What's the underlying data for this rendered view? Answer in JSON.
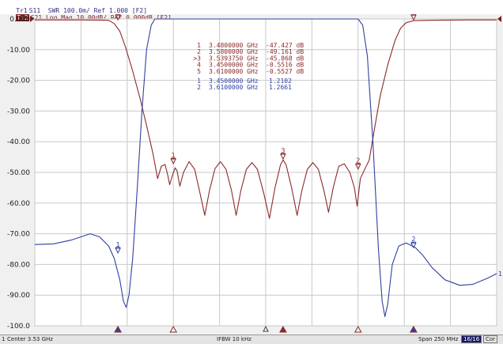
{
  "header": {
    "trace1": {
      "label": "Tr1",
      "text": "S11  SWR 100.0m/ Ref 1.000 [F2]"
    },
    "trace2": {
      "label": "Tr2",
      "text": "S21 Log Mag 10.00dB/ Ref 0.000dB [F2]"
    }
  },
  "colors": {
    "s21": "#8b2a2a",
    "s11": "#3040a0",
    "grid": "#c8c8c8",
    "plot_bg": "#ffffff",
    "ref_marker": "#7a1f1f"
  },
  "y_axis": {
    "labels": [
      "0.000",
      "-10.00",
      "-20.00",
      "-30.00",
      "-40.00",
      "-50.00",
      "-60.00",
      "-70.00",
      "-80.00",
      "-90.00",
      "-100.0"
    ]
  },
  "chart_data": {
    "type": "line",
    "x_unit": "GHz",
    "xlim": [
      3.405,
      3.655
    ],
    "ylim": [
      -100,
      0
    ],
    "y_unit": "dB",
    "grid": true,
    "series": [
      {
        "name": "S21",
        "color": "#8b2a2a",
        "points": [
          [
            3.405,
            -0.3
          ],
          [
            3.43,
            -0.3
          ],
          [
            3.44,
            -0.35
          ],
          [
            3.445,
            -0.45
          ],
          [
            3.448,
            -1.5
          ],
          [
            3.451,
            -4
          ],
          [
            3.454,
            -9
          ],
          [
            3.458,
            -17
          ],
          [
            3.462,
            -26
          ],
          [
            3.466,
            -36
          ],
          [
            3.469,
            -44
          ],
          [
            3.4715,
            -52
          ],
          [
            3.4735,
            -48
          ],
          [
            3.4755,
            -47.4
          ],
          [
            3.477,
            -51
          ],
          [
            3.478,
            -54
          ],
          [
            3.4795,
            -51
          ],
          [
            3.481,
            -48.5
          ],
          [
            3.482,
            -49.5
          ],
          [
            3.4835,
            -54.5
          ],
          [
            3.4855,
            -50
          ],
          [
            3.4885,
            -46.5
          ],
          [
            3.4915,
            -49
          ],
          [
            3.4945,
            -57
          ],
          [
            3.497,
            -64
          ],
          [
            3.4995,
            -56
          ],
          [
            3.5025,
            -48.8
          ],
          [
            3.5055,
            -46.5
          ],
          [
            3.5085,
            -49
          ],
          [
            3.5115,
            -56
          ],
          [
            3.514,
            -64
          ],
          [
            3.5165,
            -56
          ],
          [
            3.5195,
            -49
          ],
          [
            3.5225,
            -46.8
          ],
          [
            3.5255,
            -49
          ],
          [
            3.529,
            -57
          ],
          [
            3.532,
            -65
          ],
          [
            3.535,
            -55
          ],
          [
            3.538,
            -47.5
          ],
          [
            3.5394,
            -45.9
          ],
          [
            3.541,
            -47.5
          ],
          [
            3.544,
            -55
          ],
          [
            3.547,
            -64
          ],
          [
            3.5495,
            -56
          ],
          [
            3.5525,
            -49
          ],
          [
            3.5555,
            -46.8
          ],
          [
            3.5585,
            -49
          ],
          [
            3.5615,
            -56
          ],
          [
            3.564,
            -63
          ],
          [
            3.5665,
            -55
          ],
          [
            3.5695,
            -48
          ],
          [
            3.5725,
            -47.2
          ],
          [
            3.5755,
            -50
          ],
          [
            3.578,
            -55
          ],
          [
            3.5795,
            -61
          ],
          [
            3.5812,
            -52
          ],
          [
            3.584,
            -48.5
          ],
          [
            3.586,
            -46
          ],
          [
            3.5885,
            -37
          ],
          [
            3.592,
            -25
          ],
          [
            3.596,
            -15
          ],
          [
            3.6,
            -7
          ],
          [
            3.603,
            -3
          ],
          [
            3.606,
            -1.2
          ],
          [
            3.61,
            -0.55
          ],
          [
            3.62,
            -0.4
          ],
          [
            3.64,
            -0.3
          ],
          [
            3.655,
            -0.3
          ]
        ]
      },
      {
        "name": "S11",
        "color": "#3040a0",
        "points": [
          [
            3.405,
            -73.5
          ],
          [
            3.415,
            -73.3
          ],
          [
            3.425,
            -72
          ],
          [
            3.43,
            -71
          ],
          [
            3.435,
            -70
          ],
          [
            3.44,
            -71
          ],
          [
            3.445,
            -74
          ],
          [
            3.448,
            -78
          ],
          [
            3.451,
            -85
          ],
          [
            3.453,
            -92
          ],
          [
            3.4545,
            -94
          ],
          [
            3.456,
            -90
          ],
          [
            3.458,
            -78
          ],
          [
            3.4605,
            -55
          ],
          [
            3.463,
            -30
          ],
          [
            3.4655,
            -10
          ],
          [
            3.468,
            -2
          ],
          [
            3.47,
            0
          ],
          [
            3.58,
            0
          ],
          [
            3.5825,
            -2
          ],
          [
            3.585,
            -12
          ],
          [
            3.588,
            -40
          ],
          [
            3.591,
            -75
          ],
          [
            3.593,
            -92
          ],
          [
            3.5945,
            -97
          ],
          [
            3.596,
            -93
          ],
          [
            3.5985,
            -80
          ],
          [
            3.602,
            -74
          ],
          [
            3.606,
            -73
          ],
          [
            3.611,
            -74.5
          ],
          [
            3.615,
            -77
          ],
          [
            3.62,
            -81
          ],
          [
            3.627,
            -85
          ],
          [
            3.635,
            -86.8
          ],
          [
            3.642,
            -86.5
          ],
          [
            3.65,
            -84.5
          ],
          [
            3.655,
            -83
          ]
        ]
      }
    ],
    "s21_markers": [
      {
        "num": "1",
        "freq": "3.4800000 GHz",
        "value": "-47.427 dB",
        "active": false,
        "x": 3.48,
        "y": -47.427
      },
      {
        "num": "2",
        "freq": "3.5800000 GHz",
        "value": "-49.161 dB",
        "active": false,
        "x": 3.58,
        "y": -49.161
      },
      {
        "num": "3",
        "freq": "3.5393750 GHz",
        "value": "-45.868 dB",
        "active": true,
        "x": 3.539375,
        "y": -45.868
      },
      {
        "num": "4",
        "freq": "3.4500000 GHz",
        "value": "-0.5516 dB",
        "active": false,
        "x": 3.45,
        "y": -0.5516
      },
      {
        "num": "5",
        "freq": "3.6100000 GHz",
        "value": "-0.5527 dB",
        "active": false,
        "x": 3.61,
        "y": -0.5527
      }
    ],
    "s11_markers": [
      {
        "num": "1",
        "freq": "3.4500000 GHz",
        "value": "1.2102",
        "x": 3.45,
        "y": -76.5
      },
      {
        "num": "2",
        "freq": "3.6100000 GHz",
        "value": "1.2661",
        "x": 3.61,
        "y": -74.8
      }
    ]
  },
  "status_bar": {
    "left_num": "1",
    "center": "Center 3.53 GHz",
    "ifbw": "IFBW 10 kHz",
    "span": "Span 250 MHz",
    "points": "16/16",
    "mode": "Cor"
  }
}
